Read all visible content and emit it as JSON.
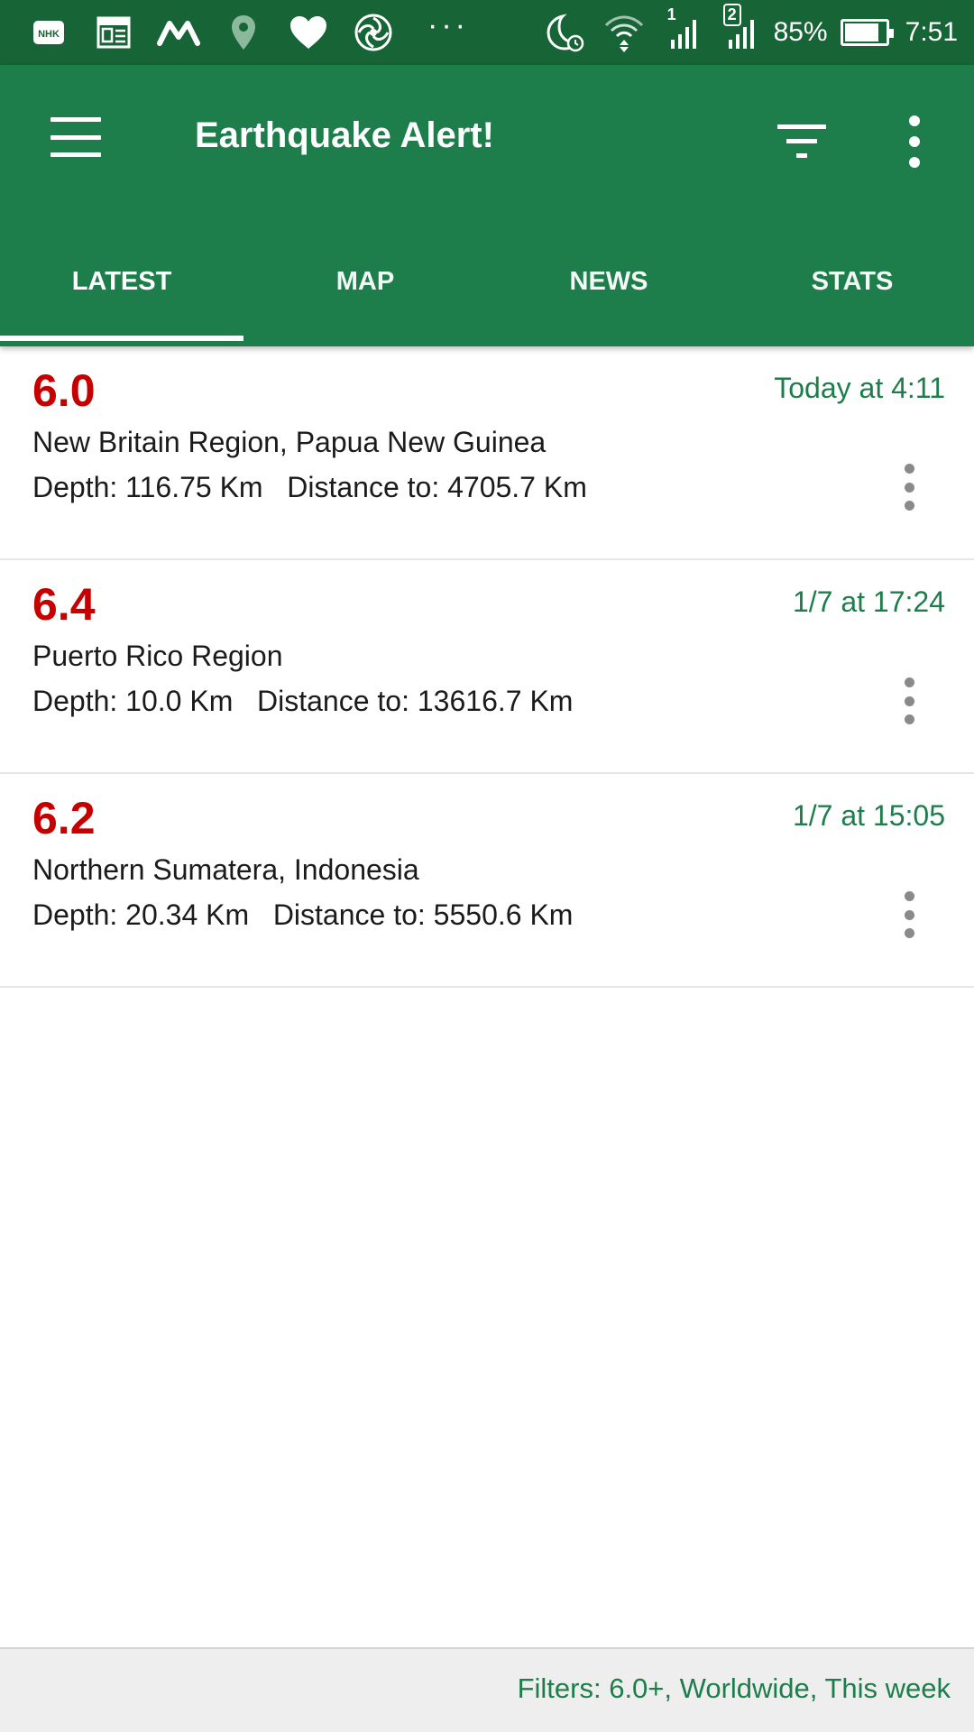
{
  "status_bar": {
    "icons_left": [
      "nhk-icon",
      "news-icon",
      "m-app-icon",
      "location-pin-icon",
      "heart-icon",
      "swirl-app-icon"
    ],
    "overflow": "···",
    "sim1_label": "1",
    "sim2_label": "2",
    "battery_percent": "85%",
    "battery_level": 0.85,
    "time": "7:51"
  },
  "app_bar": {
    "title": "Earthquake Alert!",
    "menu_icon": "hamburger-menu-icon",
    "filter_icon": "filter-icon",
    "more_icon": "more-vert-icon"
  },
  "tabs": [
    {
      "label": "LATEST",
      "selected": true
    },
    {
      "label": "MAP",
      "selected": false
    },
    {
      "label": "NEWS",
      "selected": false
    },
    {
      "label": "STATS",
      "selected": false
    }
  ],
  "quakes": [
    {
      "magnitude": "6.0",
      "time": "Today at 4:11",
      "region": "New Britain Region, Papua New Guinea",
      "details": "Depth: 116.75 Km   Distance to: 4705.7 Km"
    },
    {
      "magnitude": "6.4",
      "time": "1/7 at 17:24",
      "region": "Puerto Rico Region",
      "details": "Depth: 10.0 Km   Distance to: 13616.7 Km"
    },
    {
      "magnitude": "6.2",
      "time": "1/7 at 15:05",
      "region": "Northern Sumatera, Indonesia",
      "details": "Depth: 20.34 Km   Distance to: 5550.6 Km"
    }
  ],
  "footer": {
    "filters_text": "Filters: 6.0+, Worldwide, This week"
  },
  "colors": {
    "status_bar": "#176437",
    "primary": "#1d7d4b",
    "magnitude": "#c60000"
  }
}
